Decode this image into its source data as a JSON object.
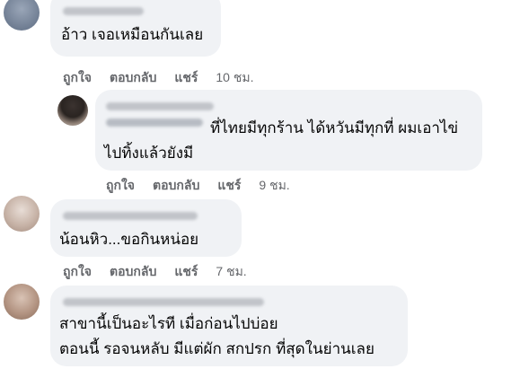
{
  "comments": [
    {
      "text_lines": [
        "อ้าว เจอเหมือนกันเลย"
      ],
      "like": "ถูกใจ",
      "reply": "ตอบกลับ",
      "share": "แชร์",
      "time": "10 ชม."
    },
    {
      "text_lines": [
        "ที่ไทยมีทุกร้าน ได้หวันมีทุกที่ ผมเอาไข่",
        "ไปทิ้งแล้วยังมี"
      ],
      "like": "ถูกใจ",
      "reply": "ตอบกลับ",
      "share": "แชร์",
      "time": "9 ชม."
    },
    {
      "text_lines": [
        "น้อนหิว...ขอกินหน่อย"
      ],
      "like": "ถูกใจ",
      "reply": "ตอบกลับ",
      "share": "แชร์",
      "time": "7 ชม."
    },
    {
      "text_lines": [
        "สาขานี้เป็นอะไรที เมื่อก่อนไปบ่อย",
        "ตอนนี้ รอจนหลับ มีแต่ผัก สกปรก ที่สุดในย่านเลย"
      ]
    }
  ],
  "colors": {
    "bubble": "#f0f2f5",
    "text": "#050505",
    "secondary": "#65676b"
  }
}
